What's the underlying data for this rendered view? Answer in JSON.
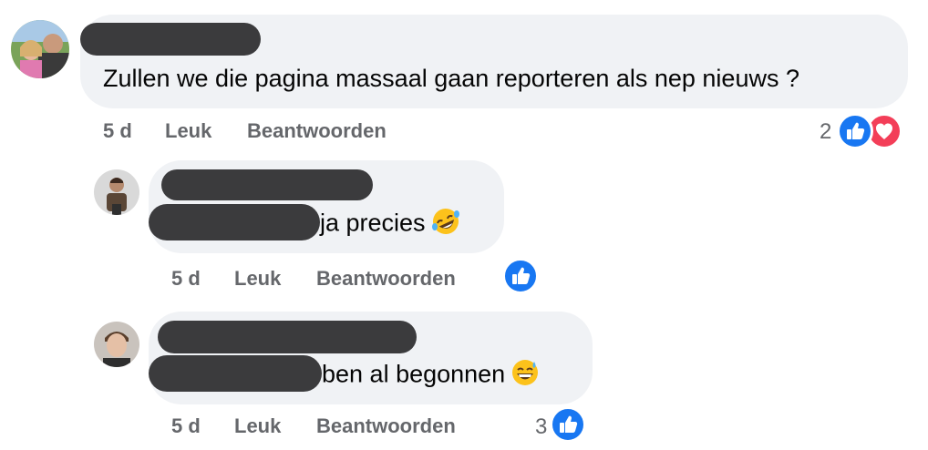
{
  "comments": [
    {
      "text": "Zullen we die pagina massaal gaan reporteren als nep nieuws ?",
      "time": "5 d",
      "like_label": "Leuk",
      "reply_label": "Beantwoorden",
      "reaction_count": "2",
      "reactions": [
        "like-icon",
        "love-icon"
      ]
    },
    {
      "text": "ja precies",
      "emoji": "rolling-on-floor-laughing-emoji",
      "time": "5 d",
      "like_label": "Leuk",
      "reply_label": "Beantwoorden",
      "reactions": [
        "like-icon"
      ]
    },
    {
      "text": "ben al begonnen",
      "emoji": "grinning-sweat-emoji",
      "time": "5 d",
      "like_label": "Leuk",
      "reply_label": "Beantwoorden",
      "reaction_count": "3",
      "reactions": [
        "like-icon"
      ]
    }
  ],
  "colors": {
    "bubble": "#f0f2f5",
    "meta_text": "#65676b",
    "like_blue": "#1877f2",
    "love_red": "#f33e58",
    "redaction": "#3b3b3d"
  }
}
